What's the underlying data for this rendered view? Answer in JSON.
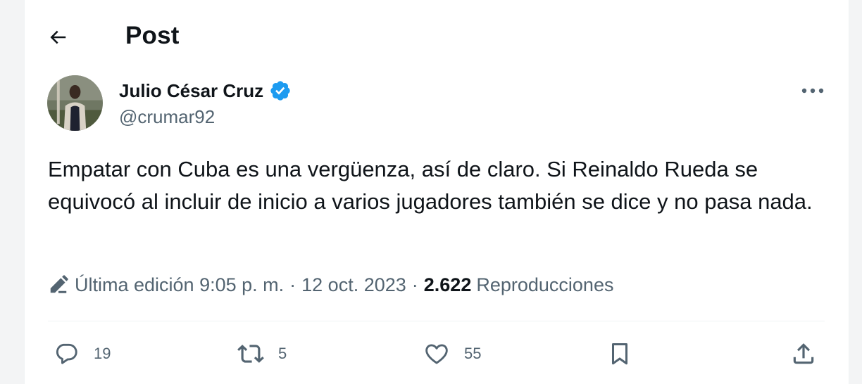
{
  "header": {
    "title": "Post"
  },
  "author": {
    "name": "Julio César Cruz",
    "handle": "@crumar92"
  },
  "post": {
    "text": "Empatar con Cuba es una vergüenza, así de claro. Si Reinaldo Rueda se equivocó al incluir de inicio a varios jugadores también se dice y no pasa nada."
  },
  "meta": {
    "edited_label": "Última edición 9:05 p. m.",
    "separator": "·",
    "date": "12 oct. 2023",
    "views_count": "2.622",
    "views_label": "Reproducciones"
  },
  "actions": {
    "replies": "19",
    "reposts": "5",
    "likes": "55"
  },
  "icons": {
    "back": "arrow-left-icon",
    "verified": "verified-badge-icon",
    "more": "more-horizontal-icon",
    "edit": "pencil-icon",
    "reply": "reply-bubble-icon",
    "repost": "repost-icon",
    "like": "heart-icon",
    "bookmark": "bookmark-icon",
    "share": "share-icon"
  },
  "colors": {
    "accent": "#1d9bf0",
    "text": "#0f1419",
    "muted": "#536471"
  }
}
